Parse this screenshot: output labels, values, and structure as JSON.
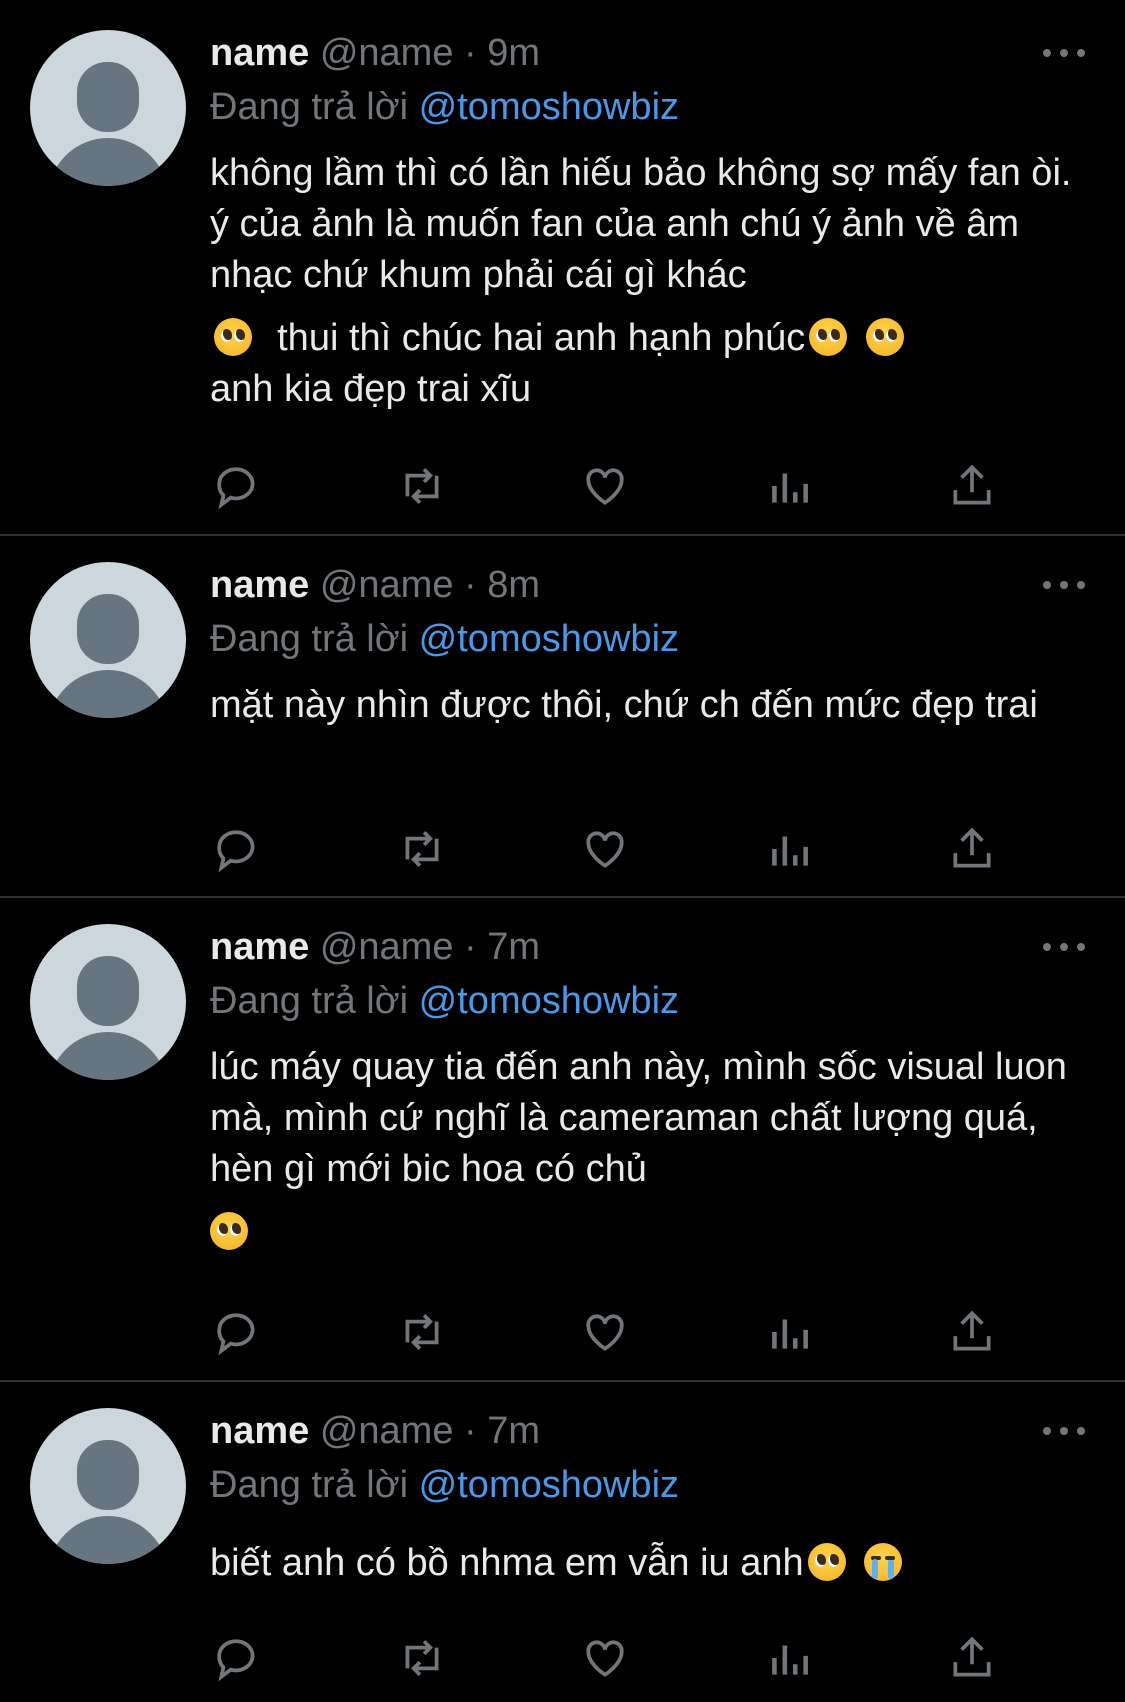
{
  "colors": {
    "background": "#000000",
    "text": "#e7e9ea",
    "secondary": "#71767b",
    "mention": "#4a99e9",
    "divider": "#2f3336"
  },
  "actions": [
    "reply-icon",
    "retweet-icon",
    "like-icon",
    "analytics-icon",
    "share-icon"
  ],
  "tweets": [
    {
      "display_name": "name",
      "handle": "@name",
      "separator": "·",
      "time": "9m",
      "reply_prefix": "Đang trả lời",
      "reply_to": "@tomoshowbiz",
      "text_paragraphs": [
        "không lầm thì có lần hiếu bảo không sợ mấy fan òi. ý của ảnh là muốn fan của anh chú ý ảnh về âm nhạc chứ khum phải cái gì khác",
        "thui thì chúc hai anh hạnh phúc",
        "anh kia đẹp trai xĩu"
      ]
    },
    {
      "display_name": "name",
      "handle": "@name",
      "separator": "·",
      "time": "8m",
      "reply_prefix": "Đang trả lời",
      "reply_to": "@tomoshowbiz",
      "text_paragraphs": [
        "mặt này nhìn được thôi, chứ ch đến mức đẹp trai"
      ]
    },
    {
      "display_name": "name",
      "handle": "@name",
      "separator": "·",
      "time": "7m",
      "reply_prefix": "Đang trả lời",
      "reply_to": "@tomoshowbiz",
      "text_paragraphs": [
        "lúc máy quay tia đến anh này, mình sốc visual luon mà, mình cứ nghĩ là cameraman chất lượng quá, hèn gì mới bic hoa có chủ"
      ]
    },
    {
      "display_name": "name",
      "handle": "@name",
      "separator": "·",
      "time": "7m",
      "reply_prefix": "Đang trả lời",
      "reply_to": "@tomoshowbiz",
      "text_paragraphs": [
        "biết anh có bồ nhma em vẫn iu anh"
      ]
    }
  ]
}
